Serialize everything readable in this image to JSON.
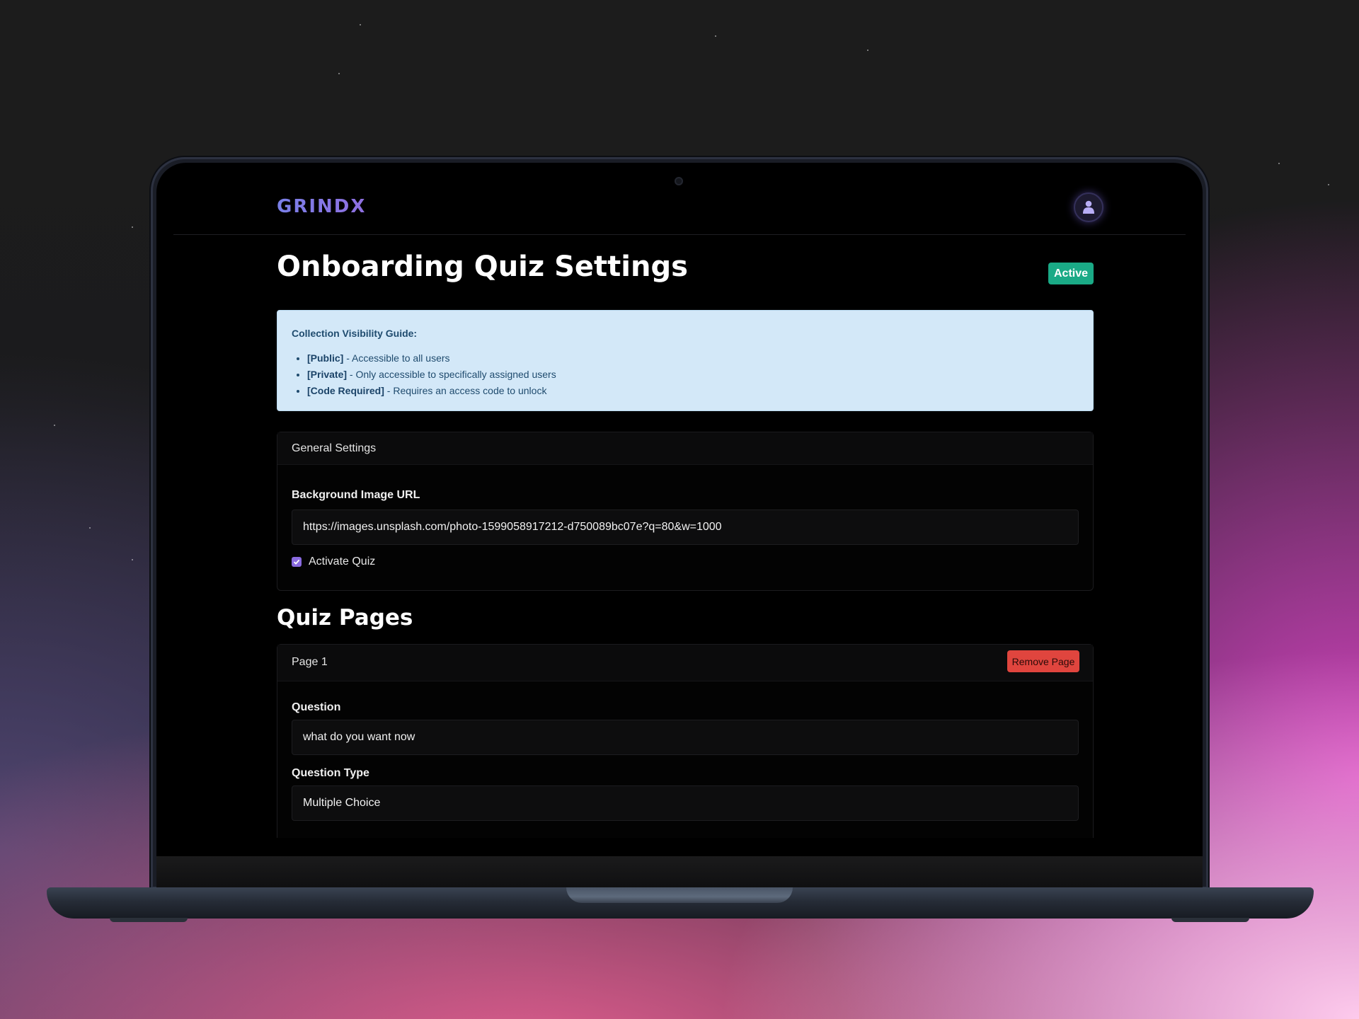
{
  "app": {
    "brand": "GRINDX"
  },
  "page": {
    "title": "Onboarding Quiz Settings",
    "status_badge": "Active"
  },
  "guide": {
    "title": "Collection Visibility Guide:",
    "items": [
      {
        "tag": "[Public]",
        "text": " - Accessible to all users"
      },
      {
        "tag": "[Private]",
        "text": " - Only accessible to specifically assigned users"
      },
      {
        "tag": "[Code Required]",
        "text": " - Requires an access code to unlock"
      }
    ]
  },
  "general": {
    "header": "General Settings",
    "bg_label": "Background Image URL",
    "bg_value": "https://images.unsplash.com/photo-1599058917212-d750089bc07e?q=80&w=1000",
    "activate_label": "Activate Quiz",
    "activate_checked": true
  },
  "quiz_pages": {
    "title": "Quiz Pages",
    "pages": [
      {
        "header": "Page 1",
        "remove_label": "Remove Page",
        "question_label": "Question",
        "question_value": "what do you want now",
        "type_label": "Question Type",
        "type_value": "Multiple Choice"
      }
    ]
  },
  "colors": {
    "accent": "#8a6be0",
    "success": "#1aaa86",
    "danger": "#e0453e",
    "info_bg": "#d3e8f8"
  },
  "icons": {
    "avatar": "user-icon",
    "checkbox": "check-icon"
  }
}
